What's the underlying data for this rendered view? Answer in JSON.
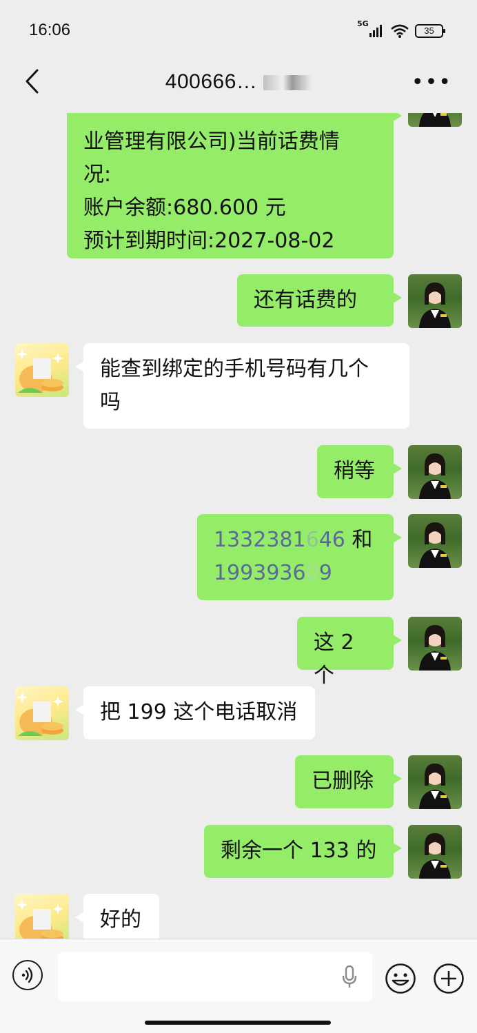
{
  "status": {
    "time": "16:06",
    "network": "5G",
    "battery": "35"
  },
  "header": {
    "title_visible": "40066",
    "title_partial": "6…",
    "more_label": "•••"
  },
  "messages": [
    {
      "side": "right",
      "lines": [
        "业管理有限公司)当前话费情",
        "况:",
        "账户余额:680.600 元",
        "预计到期时间:2027-08-02"
      ]
    },
    {
      "side": "right",
      "text": "还有话费的"
    },
    {
      "side": "left",
      "lines": [
        "能查到绑定的手机号码有几个",
        "吗"
      ]
    },
    {
      "side": "right",
      "text": "稍等"
    },
    {
      "side": "right",
      "line1_a": "1332381",
      "line1_b": "6",
      "line1_c": "46",
      "line1_d": " 和",
      "line2_a": "1993936",
      "line2_b": "0",
      "line2_c": "9"
    },
    {
      "side": "right",
      "text": "这 2 个"
    },
    {
      "side": "left",
      "text": "把 199 这个电话取消"
    },
    {
      "side": "right",
      "text": "已删除"
    },
    {
      "side": "right",
      "text": "剩余一个 133 的"
    },
    {
      "side": "left",
      "text": "好的"
    }
  ],
  "colors": {
    "bg": "#ededed",
    "green_bubble": "#95ec69",
    "white_bubble": "#ffffff",
    "link": "#576b95"
  }
}
